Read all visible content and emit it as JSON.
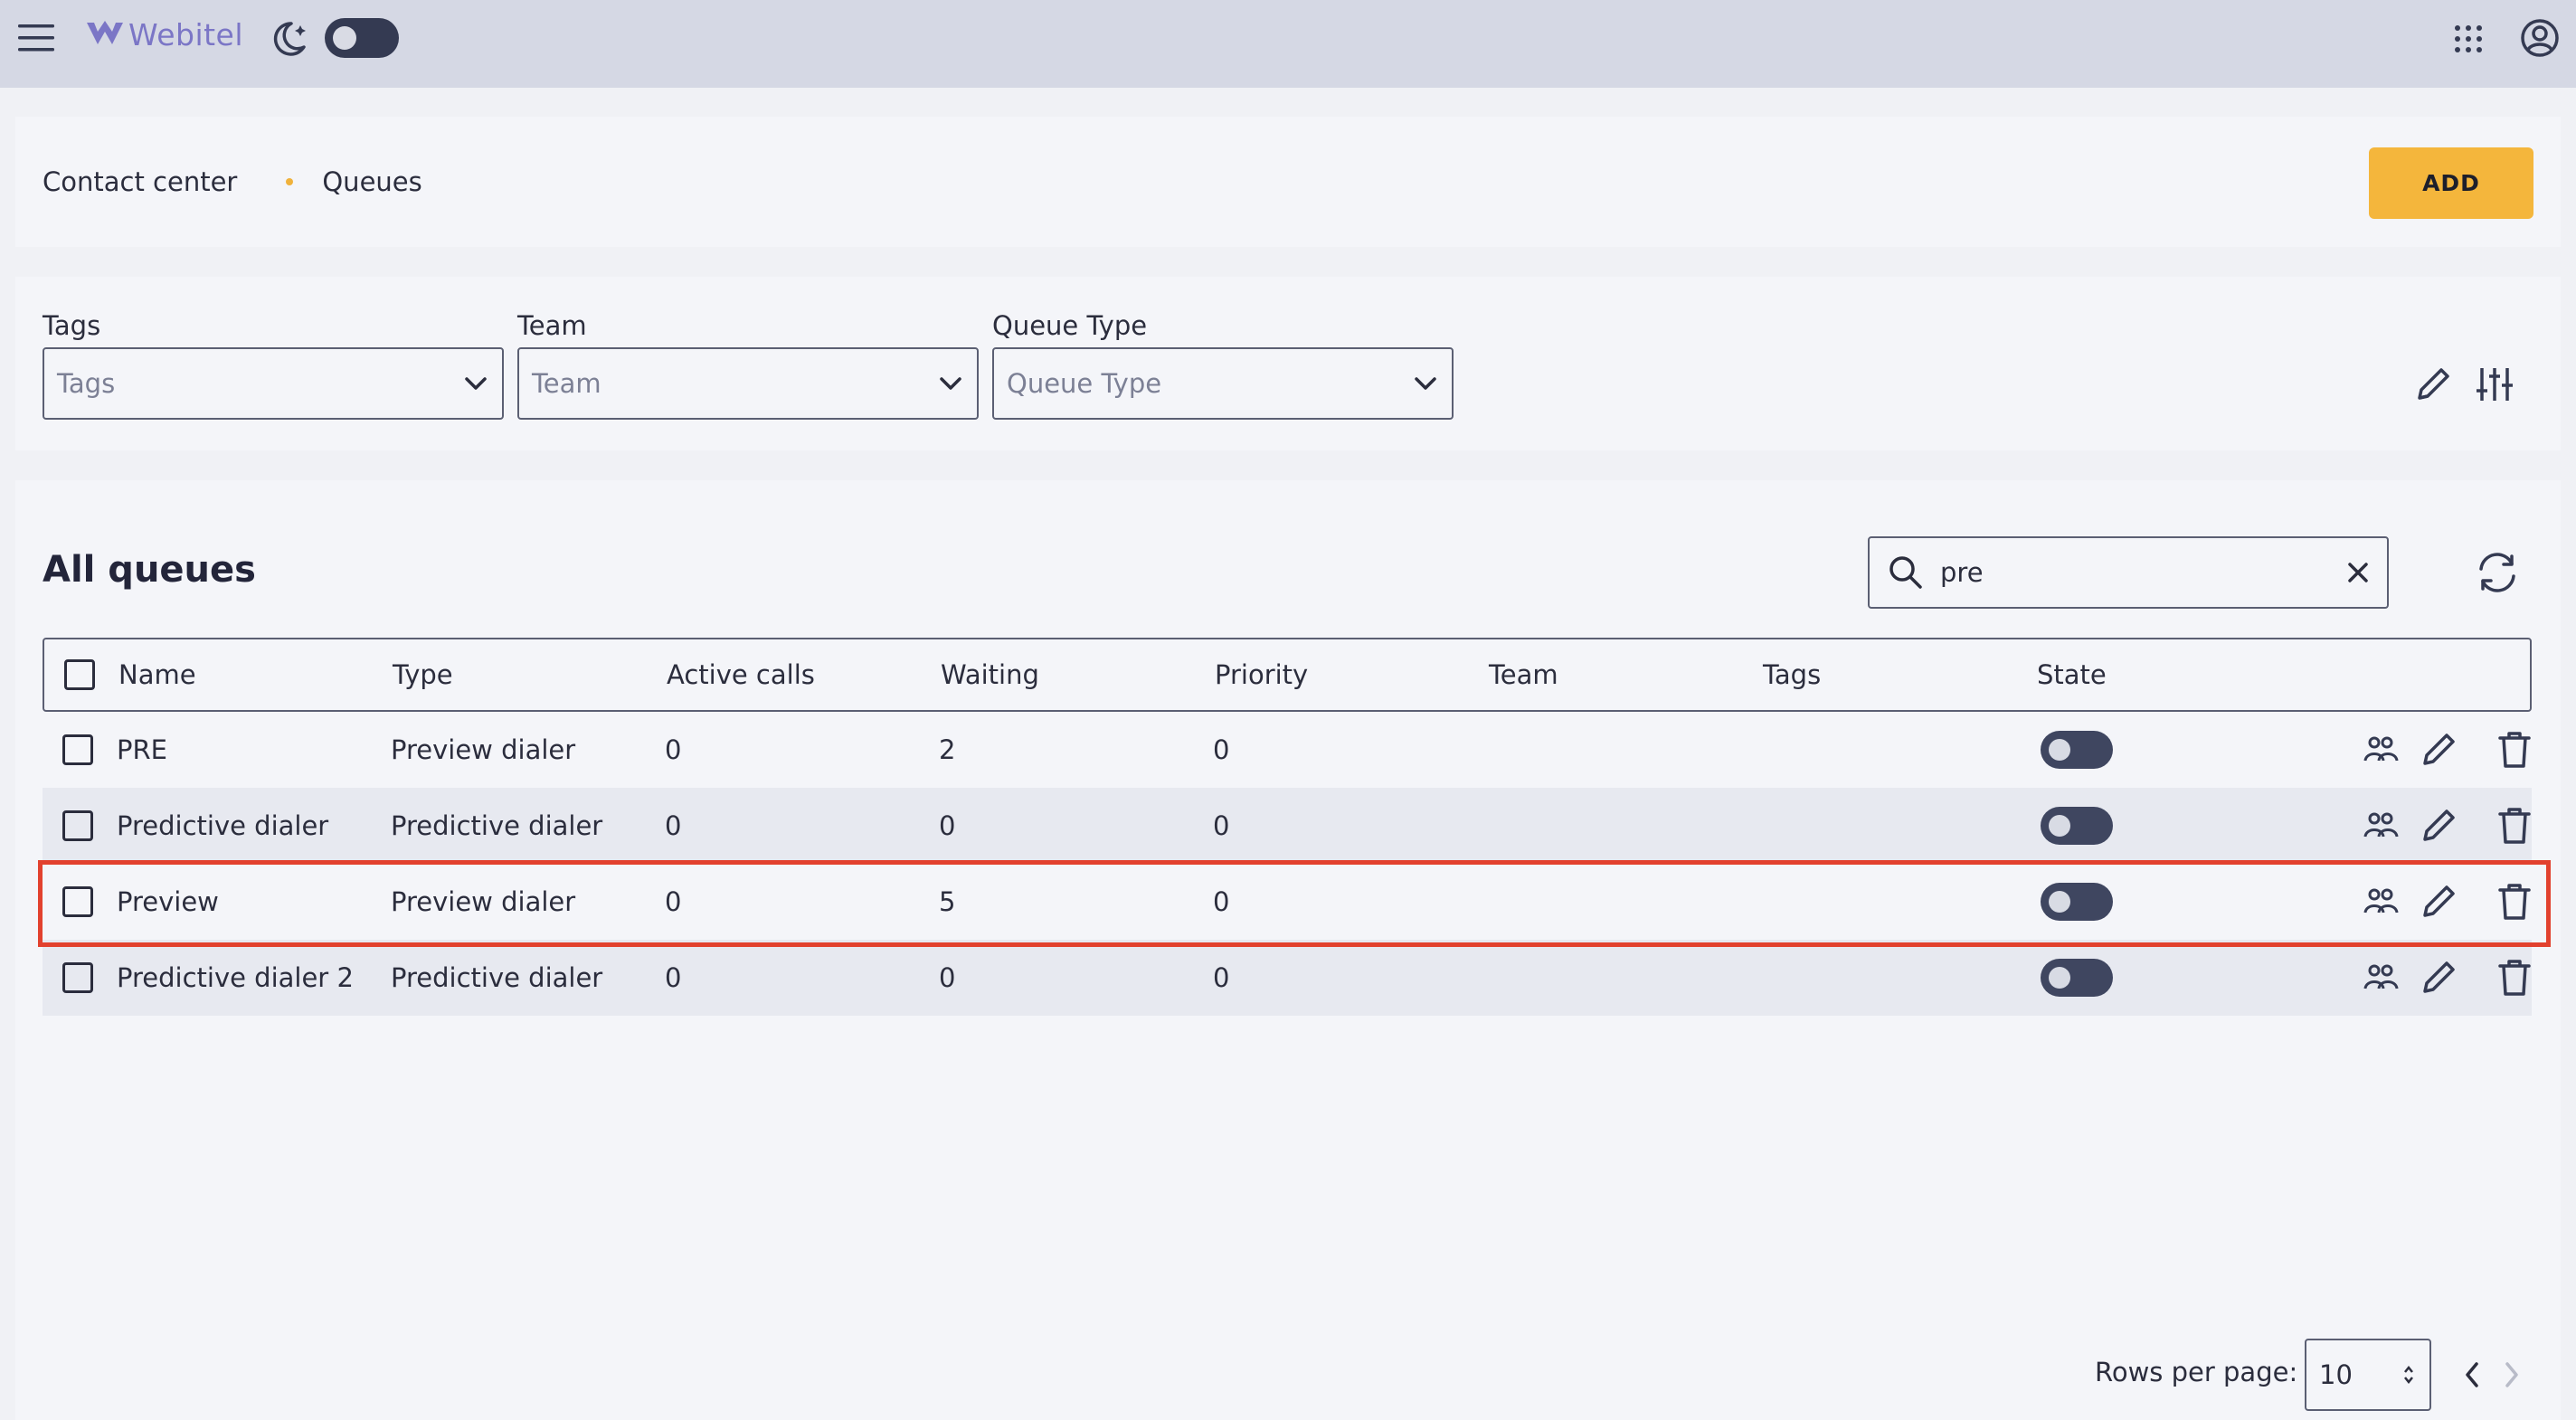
{
  "app": {
    "logo_text": "Webitel"
  },
  "breadcrumb": {
    "parent": "Contact center",
    "current": "Queues"
  },
  "header": {
    "add_label": "ADD"
  },
  "filters": [
    {
      "label": "Tags",
      "placeholder": "Tags"
    },
    {
      "label": "Team",
      "placeholder": "Team"
    },
    {
      "label": "Queue Type",
      "placeholder": "Queue Type"
    }
  ],
  "table": {
    "title": "All queues",
    "search_value": "pre",
    "columns": [
      "Name",
      "Type",
      "Active calls",
      "Waiting",
      "Priority",
      "Team",
      "Tags",
      "State"
    ],
    "rows": [
      {
        "name": "PRE",
        "type": "Preview dialer",
        "active_calls": "0",
        "waiting": "2",
        "priority": "0",
        "team": "",
        "tags": "",
        "state": false
      },
      {
        "name": "Predictive dialer",
        "type": "Predictive dialer",
        "active_calls": "0",
        "waiting": "0",
        "priority": "0",
        "team": "",
        "tags": "",
        "state": false
      },
      {
        "name": "Preview",
        "type": "Preview dialer",
        "active_calls": "0",
        "waiting": "5",
        "priority": "0",
        "team": "",
        "tags": "",
        "state": false
      },
      {
        "name": "Predictive dialer 2",
        "type": "Predictive dialer",
        "active_calls": "0",
        "waiting": "0",
        "priority": "0",
        "team": "",
        "tags": "",
        "state": false
      }
    ]
  },
  "pagination": {
    "rows_label": "Rows per page:",
    "rows_value": "10"
  },
  "colors": {
    "accent": "#f4b63c",
    "topbar": "#d5d8e4",
    "toggle": "#3f4660",
    "highlight": "#e2412e"
  },
  "icons": [
    "menu-icon",
    "logo-icon",
    "moon-icon",
    "apps-icon",
    "account-icon",
    "pencil-icon",
    "sliders-icon",
    "search-icon",
    "close-icon",
    "refresh-icon",
    "members-icon",
    "edit-icon",
    "trash-icon",
    "chevron-down-icon",
    "chevron-left-icon",
    "chevron-right-icon"
  ]
}
